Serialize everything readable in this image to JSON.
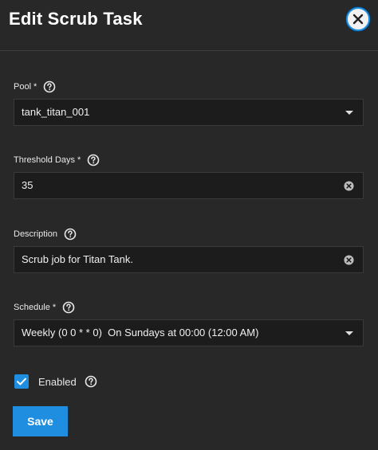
{
  "dialog": {
    "title": "Edit Scrub Task"
  },
  "fields": {
    "pool": {
      "label": "Pool",
      "required_mark": "*",
      "value": "tank_titan_001"
    },
    "threshold_days": {
      "label": "Threshold Days",
      "required_mark": "*",
      "value": "35"
    },
    "description": {
      "label": "Description",
      "value": "Scrub job for Titan Tank."
    },
    "schedule": {
      "label": "Schedule",
      "required_mark": "*",
      "value": "Weekly (0 0 * * 0)  On Sundays at 00:00 (12:00 AM)"
    },
    "enabled": {
      "label": "Enabled",
      "checked": true
    }
  },
  "actions": {
    "save_label": "Save"
  },
  "colors": {
    "accent": "#1f8ee0",
    "background": "#282828",
    "input_background": "#1c1c1c"
  },
  "icons": {
    "close": "close-icon",
    "help": "help-icon",
    "clear": "clear-icon",
    "dropdown": "chevron-down-icon",
    "check": "check-icon"
  }
}
